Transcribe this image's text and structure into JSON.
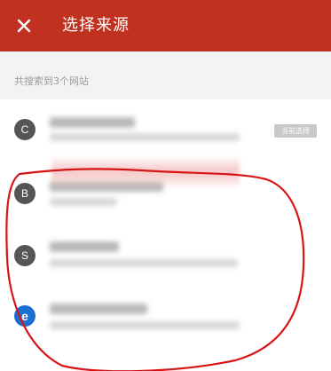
{
  "header": {
    "title": "选择来源",
    "close_icon": "close-icon",
    "background_color": "#c0311f"
  },
  "subheader": {
    "text": "共搜索到3个网站"
  },
  "sources": [
    {
      "avatar_letter": "C",
      "badge": "当前选择",
      "current": true
    },
    {
      "avatar_letter": "B",
      "current": false
    },
    {
      "avatar_letter": "S",
      "current": false
    },
    {
      "avatar_letter": "e",
      "current": false,
      "avatar_color": "#1a6fd1"
    }
  ],
  "annotation": {
    "color": "#d81414"
  }
}
